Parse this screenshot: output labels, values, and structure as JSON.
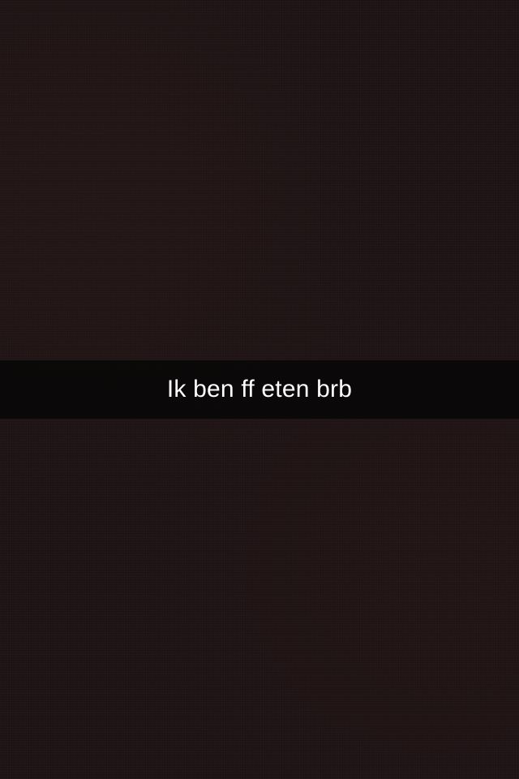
{
  "screen": {
    "background_color": "#1b1112"
  },
  "caption": {
    "text": "Ik ben ff eten brb",
    "text_color": "#ffffff",
    "bar_color": "#050505"
  }
}
